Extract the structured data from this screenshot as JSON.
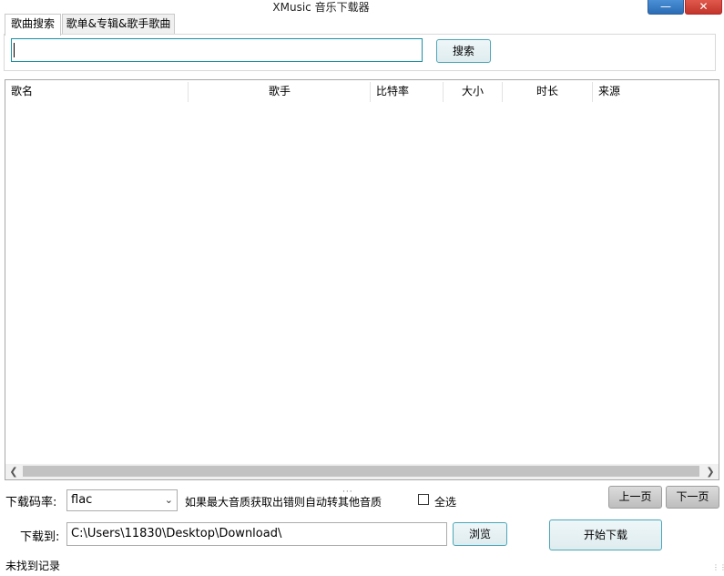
{
  "window": {
    "title": "XMusic 音乐下载器",
    "minimize_symbol": "—",
    "close_symbol": "✕"
  },
  "tabs": [
    {
      "label": "歌曲搜索",
      "active": true
    },
    {
      "label": "歌单&专辑&歌手歌曲",
      "active": false
    }
  ],
  "search": {
    "value": "",
    "button_label": "搜索"
  },
  "table": {
    "columns": [
      "歌名",
      "歌手",
      "比特率",
      "大小",
      "时长",
      "来源"
    ],
    "rows": []
  },
  "controls": {
    "bitrate_label": "下载码率:",
    "bitrate_value": "flac",
    "fallback_note": "如果最大音质获取出错则自动转其他音质",
    "select_all_label": "全选",
    "select_all_checked": false,
    "prev_page_label": "上一页",
    "next_page_label": "下一页",
    "download_to_label": "下载到:",
    "download_path": "C:\\Users\\11830\\Desktop\\Download\\",
    "browse_label": "浏览",
    "start_download_label": "开始下载"
  },
  "status": {
    "text": "未找到记录"
  },
  "icons": {
    "dropdown": "chevron-down-icon",
    "scroll_left": "arrow-left-icon",
    "scroll_right": "arrow-right-icon"
  }
}
